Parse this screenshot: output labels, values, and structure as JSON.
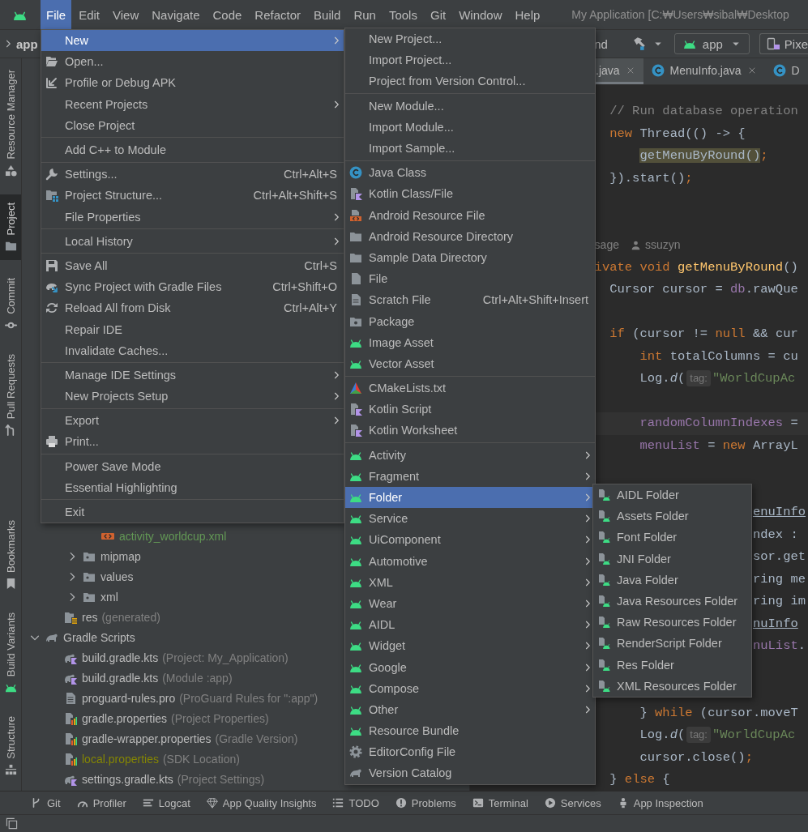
{
  "menu_bar": {
    "items": [
      {
        "label": "File",
        "selected": true
      },
      {
        "label": "Edit",
        "selected": false
      },
      {
        "label": "View",
        "selected": false
      },
      {
        "label": "Navigate",
        "selected": false
      },
      {
        "label": "Code",
        "selected": false
      },
      {
        "label": "Refactor",
        "selected": false
      },
      {
        "label": "Build",
        "selected": false
      },
      {
        "label": "Run",
        "selected": false
      },
      {
        "label": "Tools",
        "selected": false
      },
      {
        "label": "Git",
        "selected": false
      },
      {
        "label": "Window",
        "selected": false
      },
      {
        "label": "Help",
        "selected": false
      }
    ],
    "window_title": "My Application [C:₩Users₩sibal₩Desktop"
  },
  "toolbar": {
    "breadcrumb": "app",
    "fragment": "nd",
    "run_config": "app",
    "device": "Pixe"
  },
  "tool_strip": {
    "top": [
      {
        "label": "Resource Manager",
        "selected": false
      },
      {
        "label": "Project",
        "selected": true
      },
      {
        "label": "Commit",
        "selected": false
      },
      {
        "label": "Pull Requests",
        "selected": false
      }
    ],
    "bottom": [
      {
        "label": "Bookmarks",
        "selected": false
      },
      {
        "label": "Build Variants",
        "selected": false
      },
      {
        "label": "Structure",
        "selected": false
      }
    ]
  },
  "project_tree": [
    {
      "children": [
        {
          "children": [
            {
              "children": [
                {
                  "label": "activity_worldcup.xml",
                  "kind": "xml",
                  "color": "#629755"
                }
              ]
            },
            {
              "label": "mipmap",
              "kind": "folder",
              "color": "#bbbbbb",
              "expanded": false
            },
            {
              "label": "values",
              "kind": "folder",
              "color": "#bbbbbb",
              "expanded": false
            },
            {
              "label": "xml",
              "kind": "folder",
              "color": "#bbbbbb",
              "expanded": false
            }
          ]
        },
        {
          "label": "res",
          "note": "(generated)",
          "kind": "generated_res",
          "color": "#bbbbbb"
        }
      ]
    },
    {
      "label": "Gradle Scripts",
      "kind": "gradle_group",
      "color": "#bbbbbb",
      "expanded": true,
      "children": [
        {
          "label": "build.gradle.kts",
          "note": "(Project: My_Application)",
          "kind": "gradle_kts",
          "color": "#bbbbbb"
        },
        {
          "label": "build.gradle.kts",
          "note": "(Module :app)",
          "kind": "gradle_kts",
          "color": "#bbbbbb"
        },
        {
          "label": "proguard-rules.pro",
          "note": "(ProGuard Rules for \":app\")",
          "kind": "pro",
          "color": "#bbbbbb"
        },
        {
          "label": "gradle.properties",
          "note": "(Project Properties)",
          "kind": "properties",
          "color": "#bbbbbb"
        },
        {
          "label": "gradle-wrapper.properties",
          "note": "(Gradle Version)",
          "kind": "properties",
          "color": "#bbbbbb"
        },
        {
          "label": "local.properties",
          "note": "(SDK Location)",
          "kind": "properties",
          "color": "#848504"
        },
        {
          "label": "settings.gradle.kts",
          "note": "(Project Settings)",
          "kind": "gradle_kts",
          "color": "#bbbbbb"
        }
      ]
    }
  ],
  "editor_tabs": [
    {
      "label": ".java",
      "selected": true,
      "closable": true
    },
    {
      "label": "MenuInfo.java",
      "selected": false,
      "closable": true
    },
    {
      "label": "D",
      "selected": false,
      "closable": false
    }
  ],
  "editor": {
    "lines": [
      {
        "kind": "code",
        "current": false,
        "tokens": [
          {
            "text": "// Run database operation",
            "kind": "comment"
          }
        ]
      },
      {
        "kind": "code",
        "current": false,
        "tokens": [
          {
            "text": "new",
            "kind": "keyword"
          },
          {
            "text": " Thread(() -> {",
            "kind": "plain"
          }
        ]
      },
      {
        "kind": "code",
        "current": false,
        "tokens": [
          {
            "text": "getMenuByRound()",
            "kind": "highlight"
          },
          {
            "text": ";",
            "kind": "punct"
          }
        ]
      },
      {
        "kind": "code",
        "current": false,
        "tokens": [
          {
            "text": "}).start()",
            "kind": "plain"
          },
          {
            "text": ";",
            "kind": "punct"
          }
        ]
      },
      {
        "kind": "blank"
      },
      {
        "kind": "blank"
      },
      {
        "kind": "code_vision",
        "usages": "sage",
        "author": "ssuzyn"
      },
      {
        "kind": "code",
        "current": false,
        "tokens": [
          {
            "text": "ivate void ",
            "kind": "keyword"
          },
          {
            "text": "getMenuByRound",
            "kind": "method"
          },
          {
            "text": "()",
            "kind": "plain"
          }
        ]
      },
      {
        "kind": "code",
        "current": false,
        "tokens": [
          {
            "text": "Cursor cursor = ",
            "kind": "plain"
          },
          {
            "text": "db",
            "kind": "field"
          },
          {
            "text": ".rawQue",
            "kind": "plain"
          }
        ]
      },
      {
        "kind": "blank"
      },
      {
        "kind": "code",
        "current": false,
        "tokens": [
          {
            "text": "if",
            "kind": "keyword"
          },
          {
            "text": " (cursor != ",
            "kind": "plain"
          },
          {
            "text": "null",
            "kind": "keyword"
          },
          {
            "text": " && cur",
            "kind": "plain"
          }
        ]
      },
      {
        "kind": "code",
        "current": false,
        "tokens": [
          {
            "text": "int",
            "kind": "keyword"
          },
          {
            "text": " totalColumns = cu",
            "kind": "plain"
          }
        ]
      },
      {
        "kind": "code",
        "current": false,
        "tokens": [
          {
            "text": "Log.",
            "kind": "plain"
          },
          {
            "text": "d",
            "kind": "italic"
          },
          {
            "text": "(",
            "kind": "plain"
          },
          {
            "text": "tag:",
            "kind": "inlay"
          },
          {
            "text": "\"WorldCupAc",
            "kind": "string"
          }
        ]
      },
      {
        "kind": "blank"
      },
      {
        "kind": "code",
        "current": true,
        "tokens": [
          {
            "text": "randomColumnIndexes",
            "kind": "field"
          },
          {
            "text": " =",
            "kind": "plain"
          }
        ]
      },
      {
        "kind": "code",
        "current": false,
        "tokens": [
          {
            "text": "menuList",
            "kind": "field"
          },
          {
            "text": " = ",
            "kind": "plain"
          },
          {
            "text": "new",
            "kind": "keyword"
          },
          {
            "text": " ArrayL",
            "kind": "plain"
          }
        ]
      },
      {
        "kind": "blank"
      },
      {
        "kind": "blank"
      },
      {
        "kind": "code",
        "current": false,
        "tokens": [
          {
            "text": "enuInfo",
            "kind": "link"
          }
        ]
      },
      {
        "kind": "code",
        "current": false,
        "tokens": [
          {
            "text": "ndex :",
            "kind": "plain"
          }
        ]
      },
      {
        "kind": "code",
        "current": false,
        "tokens": [
          {
            "text": "sor.get",
            "kind": "plain"
          }
        ]
      },
      {
        "kind": "code",
        "current": false,
        "tokens": [
          {
            "text": "ring me",
            "kind": "plain"
          }
        ]
      },
      {
        "kind": "code",
        "current": false,
        "tokens": [
          {
            "text": "ring im",
            "kind": "plain"
          }
        ]
      },
      {
        "kind": "code",
        "current": false,
        "tokens": [
          {
            "text": "nuInfo",
            "kind": "link"
          }
        ]
      },
      {
        "kind": "code",
        "current": false,
        "tokens": [
          {
            "text": "nuList",
            "kind": "field"
          },
          {
            "text": ".",
            "kind": "plain"
          }
        ]
      },
      {
        "kind": "blank"
      },
      {
        "kind": "blank"
      },
      {
        "kind": "code",
        "current": false,
        "tokens": [
          {
            "text": "} ",
            "kind": "plain"
          },
          {
            "text": "while",
            "kind": "keyword"
          },
          {
            "text": " (cursor.moveT",
            "kind": "plain"
          }
        ]
      },
      {
        "kind": "code",
        "current": false,
        "tokens": [
          {
            "text": "Log.",
            "kind": "plain"
          },
          {
            "text": "d",
            "kind": "italic"
          },
          {
            "text": "(",
            "kind": "plain"
          },
          {
            "text": "tag:",
            "kind": "inlay"
          },
          {
            "text": "\"WorldCupAc",
            "kind": "string"
          }
        ]
      },
      {
        "kind": "code",
        "current": false,
        "tokens": [
          {
            "text": "cursor.close()",
            "kind": "plain"
          },
          {
            "text": ";",
            "kind": "punct"
          }
        ]
      },
      {
        "kind": "code",
        "current": false,
        "tokens": [
          {
            "text": "} ",
            "kind": "plain"
          },
          {
            "text": "else",
            "kind": "keyword"
          },
          {
            "text": " {",
            "kind": "plain"
          }
        ]
      }
    ]
  },
  "file_menu": {
    "items": [
      {
        "kind": "item",
        "label": "New",
        "selected": true,
        "submenu": true
      },
      {
        "kind": "item",
        "label": "Open...",
        "selected": false,
        "submenu": false
      },
      {
        "kind": "item",
        "label": "Profile or Debug APK",
        "selected": false,
        "submenu": false
      },
      {
        "kind": "item",
        "label": "Recent Projects",
        "selected": false,
        "submenu": true
      },
      {
        "kind": "item",
        "label": "Close Project",
        "selected": false,
        "submenu": false
      },
      {
        "kind": "separator"
      },
      {
        "kind": "item",
        "label": "Add C++ to Module",
        "selected": false,
        "submenu": false
      },
      {
        "kind": "separator"
      },
      {
        "kind": "item",
        "label": "Settings...",
        "shortcut": "Ctrl+Alt+S",
        "selected": false,
        "submenu": false
      },
      {
        "kind": "item",
        "label": "Project Structure...",
        "shortcut": "Ctrl+Alt+Shift+S",
        "selected": false,
        "submenu": false
      },
      {
        "kind": "item",
        "label": "File Properties",
        "selected": false,
        "submenu": true
      },
      {
        "kind": "separator"
      },
      {
        "kind": "item",
        "label": "Local History",
        "selected": false,
        "submenu": true
      },
      {
        "kind": "separator"
      },
      {
        "kind": "item",
        "label": "Save All",
        "shortcut": "Ctrl+S",
        "selected": false,
        "submenu": false
      },
      {
        "kind": "item",
        "label": "Sync Project with Gradle Files",
        "shortcut": "Ctrl+Shift+O",
        "selected": false,
        "submenu": false
      },
      {
        "kind": "item",
        "label": "Reload All from Disk",
        "shortcut": "Ctrl+Alt+Y",
        "selected": false,
        "submenu": false
      },
      {
        "kind": "item",
        "label": "Repair IDE",
        "selected": false,
        "submenu": false
      },
      {
        "kind": "item",
        "label": "Invalidate Caches...",
        "selected": false,
        "submenu": false
      },
      {
        "kind": "separator"
      },
      {
        "kind": "item",
        "label": "Manage IDE Settings",
        "selected": false,
        "submenu": true
      },
      {
        "kind": "item",
        "label": "New Projects Setup",
        "selected": false,
        "submenu": true
      },
      {
        "kind": "separator"
      },
      {
        "kind": "item",
        "label": "Export",
        "selected": false,
        "submenu": true
      },
      {
        "kind": "item",
        "label": "Print...",
        "selected": false,
        "submenu": false
      },
      {
        "kind": "separator"
      },
      {
        "kind": "item",
        "label": "Power Save Mode",
        "selected": false,
        "submenu": false
      },
      {
        "kind": "item",
        "label": "Essential Highlighting",
        "selected": false,
        "submenu": false
      },
      {
        "kind": "separator"
      },
      {
        "kind": "item",
        "label": "Exit",
        "selected": false,
        "submenu": false
      }
    ]
  },
  "new_submenu": {
    "items": [
      {
        "kind": "item",
        "label": "New Project...",
        "selected": false,
        "submenu": false
      },
      {
        "kind": "item",
        "label": "Import Project...",
        "selected": false,
        "submenu": false
      },
      {
        "kind": "item",
        "label": "Project from Version Control...",
        "selected": false,
        "submenu": false
      },
      {
        "kind": "separator"
      },
      {
        "kind": "item",
        "label": "New Module...",
        "selected": false,
        "submenu": false
      },
      {
        "kind": "item",
        "label": "Import Module...",
        "selected": false,
        "submenu": false
      },
      {
        "kind": "item",
        "label": "Import Sample...",
        "selected": false,
        "submenu": false
      },
      {
        "kind": "separator"
      },
      {
        "kind": "item",
        "label": "Java Class",
        "selected": false,
        "submenu": false
      },
      {
        "kind": "item",
        "label": "Kotlin Class/File",
        "selected": false,
        "submenu": false
      },
      {
        "kind": "item",
        "label": "Android Resource File",
        "selected": false,
        "submenu": false
      },
      {
        "kind": "item",
        "label": "Android Resource Directory",
        "selected": false,
        "submenu": false
      },
      {
        "kind": "item",
        "label": "Sample Data Directory",
        "selected": false,
        "submenu": false
      },
      {
        "kind": "item",
        "label": "File",
        "selected": false,
        "submenu": false
      },
      {
        "kind": "item",
        "label": "Scratch File",
        "shortcut": "Ctrl+Alt+Shift+Insert",
        "selected": false,
        "submenu": false
      },
      {
        "kind": "item",
        "label": "Package",
        "selected": false,
        "submenu": false
      },
      {
        "kind": "item",
        "label": "Image Asset",
        "selected": false,
        "submenu": false
      },
      {
        "kind": "item",
        "label": "Vector Asset",
        "selected": false,
        "submenu": false
      },
      {
        "kind": "separator"
      },
      {
        "kind": "item",
        "label": "CMakeLists.txt",
        "selected": false,
        "submenu": false
      },
      {
        "kind": "item",
        "label": "Kotlin Script",
        "selected": false,
        "submenu": false
      },
      {
        "kind": "item",
        "label": "Kotlin Worksheet",
        "selected": false,
        "submenu": false
      },
      {
        "kind": "separator"
      },
      {
        "kind": "item",
        "label": "Activity",
        "selected": false,
        "submenu": true
      },
      {
        "kind": "item",
        "label": "Fragment",
        "selected": false,
        "submenu": true
      },
      {
        "kind": "item",
        "label": "Folder",
        "selected": true,
        "submenu": true
      },
      {
        "kind": "item",
        "label": "Service",
        "selected": false,
        "submenu": true
      },
      {
        "kind": "item",
        "label": "UiComponent",
        "selected": false,
        "submenu": true
      },
      {
        "kind": "item",
        "label": "Automotive",
        "selected": false,
        "submenu": true
      },
      {
        "kind": "item",
        "label": "XML",
        "selected": false,
        "submenu": true
      },
      {
        "kind": "item",
        "label": "Wear",
        "selected": false,
        "submenu": true
      },
      {
        "kind": "item",
        "label": "AIDL",
        "selected": false,
        "submenu": true
      },
      {
        "kind": "item",
        "label": "Widget",
        "selected": false,
        "submenu": true
      },
      {
        "kind": "item",
        "label": "Google",
        "selected": false,
        "submenu": true
      },
      {
        "kind": "item",
        "label": "Compose",
        "selected": false,
        "submenu": true
      },
      {
        "kind": "item",
        "label": "Other",
        "selected": false,
        "submenu": true
      },
      {
        "kind": "item",
        "label": "Resource Bundle",
        "selected": false,
        "submenu": false
      },
      {
        "kind": "item",
        "label": "EditorConfig File",
        "selected": false,
        "submenu": false
      },
      {
        "kind": "item",
        "label": "Version Catalog",
        "selected": false,
        "submenu": false
      }
    ]
  },
  "folder_submenu": {
    "items": [
      {
        "kind": "item",
        "label": "AIDL Folder",
        "selected": false,
        "submenu": false
      },
      {
        "kind": "item",
        "label": "Assets Folder",
        "selected": false,
        "submenu": false
      },
      {
        "kind": "item",
        "label": "Font Folder",
        "selected": false,
        "submenu": false
      },
      {
        "kind": "item",
        "label": "JNI Folder",
        "selected": false,
        "submenu": false
      },
      {
        "kind": "item",
        "label": "Java Folder",
        "selected": false,
        "submenu": false
      },
      {
        "kind": "item",
        "label": "Java Resources Folder",
        "selected": false,
        "submenu": false
      },
      {
        "kind": "item",
        "label": "Raw Resources Folder",
        "selected": false,
        "submenu": false
      },
      {
        "kind": "item",
        "label": "RenderScript Folder",
        "selected": false,
        "submenu": false
      },
      {
        "kind": "item",
        "label": "Res Folder",
        "selected": false,
        "submenu": false
      },
      {
        "kind": "item",
        "label": "XML Resources Folder",
        "selected": false,
        "submenu": false
      }
    ]
  },
  "tool_window_bar": [
    {
      "label": "Git"
    },
    {
      "label": "Profiler"
    },
    {
      "label": "Logcat"
    },
    {
      "label": "App Quality Insights"
    },
    {
      "label": "TODO"
    },
    {
      "label": "Problems"
    },
    {
      "label": "Terminal"
    },
    {
      "label": "Services"
    },
    {
      "label": "App Inspection"
    }
  ]
}
